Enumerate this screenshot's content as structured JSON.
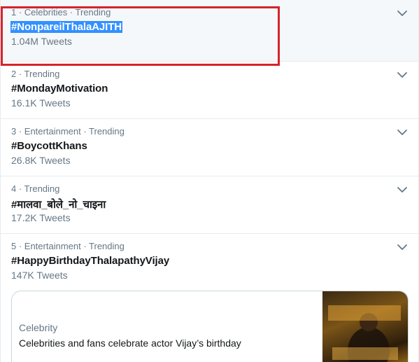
{
  "trends": [
    {
      "meta": "1 · Celebrities · Trending",
      "name": "#NonpareilThalaAJITH",
      "count": "1.04M Tweets"
    },
    {
      "meta": "2 · Trending",
      "name": "#MondayMotivation",
      "count": "16.1K Tweets"
    },
    {
      "meta": "3 · Entertainment · Trending",
      "name": "#BoycottKhans",
      "count": "26.8K Tweets"
    },
    {
      "meta": "4 · Trending",
      "name": "#मालवा_बोले_नो_चाइना",
      "count": "17.2K Tweets"
    },
    {
      "meta": "5 · Entertainment · Trending",
      "name": "#HappyBirthdayThalapathyVijay",
      "count": "147K Tweets"
    }
  ],
  "card": {
    "category": "Celebrity",
    "title": "Celebrities and fans celebrate actor Vijay’s birthday"
  },
  "colors": {
    "highlight_box": "#d6232c",
    "selection": "#3390ff",
    "secondary_text": "#657786"
  },
  "icons": {
    "chevron": "chevron-down-icon"
  }
}
